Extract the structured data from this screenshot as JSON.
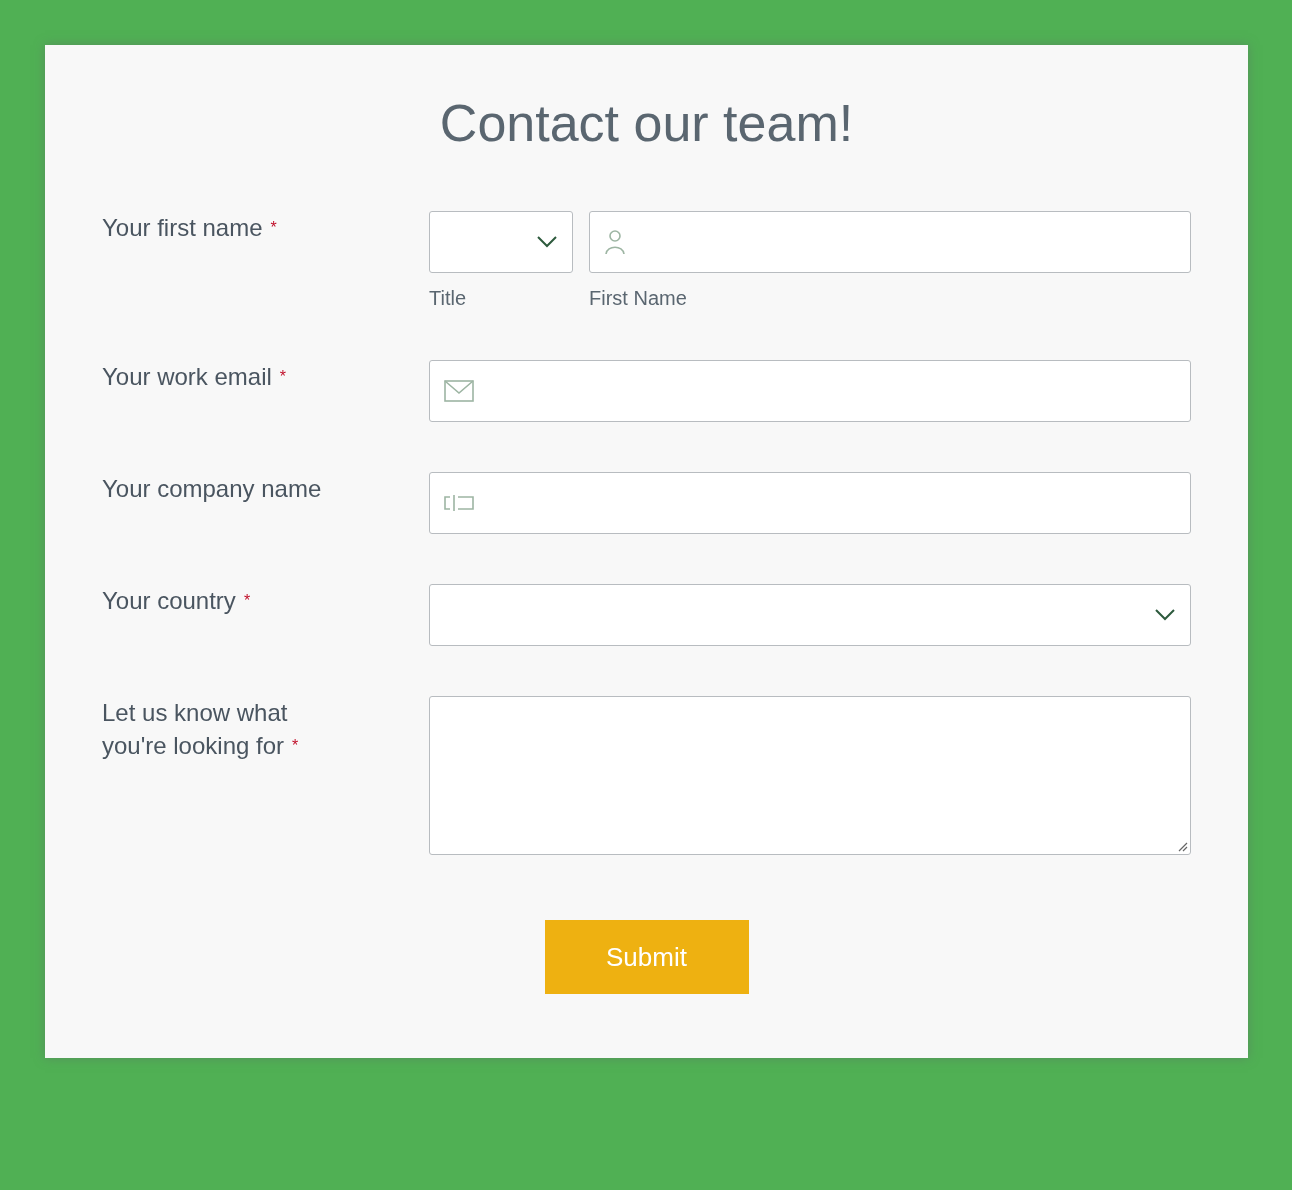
{
  "title": "Contact our team!",
  "fields": [
    {
      "kind": "name-pair",
      "label": "Your first name",
      "required_mark": "*",
      "parts": [
        {
          "kind": "select",
          "caption": "Title"
        },
        {
          "kind": "person",
          "caption": "First Name"
        }
      ]
    },
    {
      "kind": "email",
      "label": "Your work email",
      "required_mark": "*"
    },
    {
      "kind": "company",
      "label": "Your company name"
    },
    {
      "kind": "select",
      "label": "Your country",
      "required_mark": "*"
    },
    {
      "kind": "textarea",
      "label": "Let us know what you're looking for",
      "required_mark": "*"
    }
  ],
  "submit": "Submit"
}
